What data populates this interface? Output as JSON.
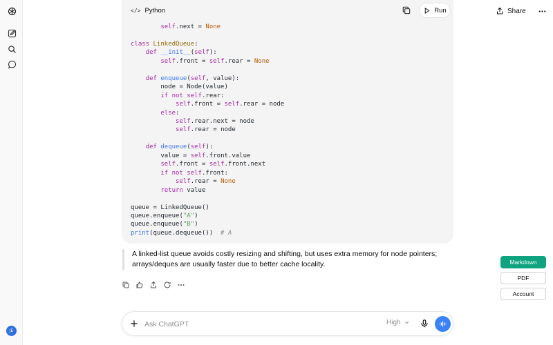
{
  "user": {
    "initials": "JE"
  },
  "topbar": {
    "share_label": "Share"
  },
  "code_block": {
    "language": "Python",
    "run_label": "Run"
  },
  "response": {
    "paragraph": "A linked-list queue avoids costly resizing and shifting, but uses extra memory for node pointers; arrays/deques are usually faster due to better cache locality."
  },
  "export": {
    "markdown_label": "Markdown",
    "pdf_label": "PDF",
    "account_label": "Account"
  },
  "composer": {
    "placeholder": "Ask ChatGPT",
    "model_label": "High"
  },
  "colors": {
    "accent_green": "#10a37f",
    "voice_blue": "#3b82f6",
    "avatar_blue": "#2f6fde"
  }
}
